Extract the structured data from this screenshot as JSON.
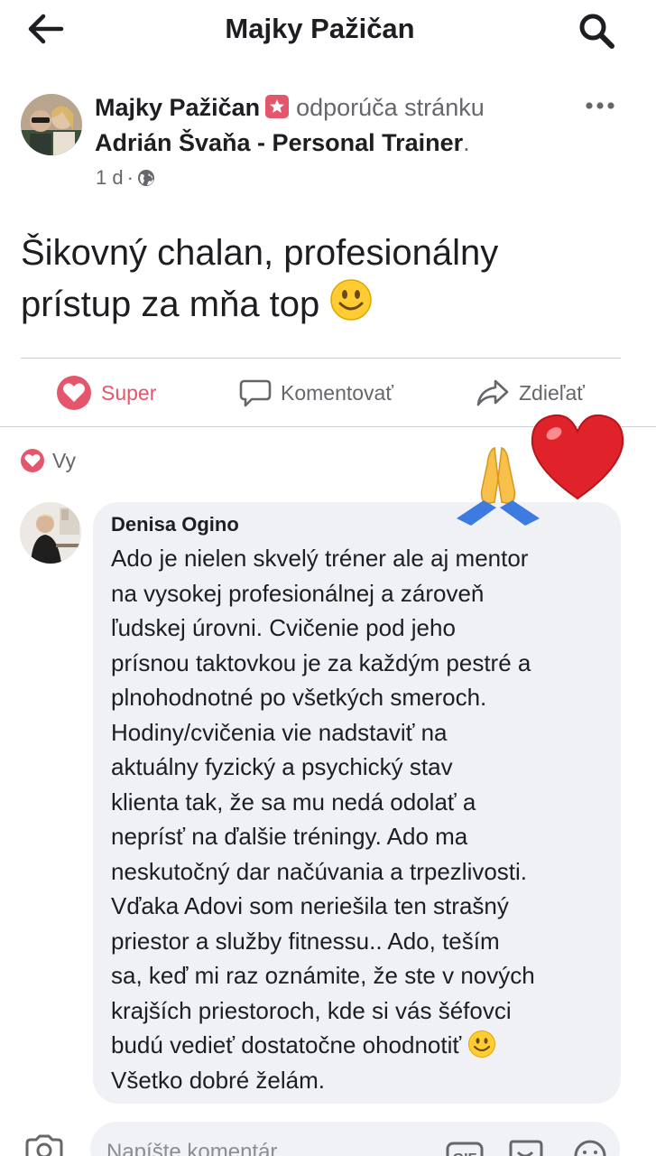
{
  "header": {
    "title": "Majky Pažičan",
    "back_icon": "arrow-left-icon",
    "search_icon": "search-icon"
  },
  "post": {
    "author": "Majky Pažičan",
    "verb": "odporúča stránku",
    "page": "Adrián Švaňa - Personal Trainer",
    "period": ".",
    "time": "1 d",
    "time_separator": "·",
    "privacy_icon": "globe-icon",
    "text_line1": "Šikovný chalan, profesionálny",
    "text_line2": "prístup za mňa top",
    "text_emoji": "slightly-smiling-face"
  },
  "actions": {
    "super": "Super",
    "comment": "Komentovať",
    "share": "Zdieľať"
  },
  "reactions": {
    "label": "Vy",
    "icon": "love-reaction-icon",
    "color": "#e4566c"
  },
  "comment": {
    "author": "Denisa Ogino",
    "lines": [
      "Ado je nielen skvelý tréner ale aj mentor",
      "na vysokej profesionálnej a zároveň",
      "ľudskej úrovni. Cvičenie pod jeho",
      "prísnou taktovkou je za každým pestré a",
      "plnohodnotné po všetkých smeroch.",
      "Hodiny/cvičenia vie nadstaviť na",
      "aktuálny fyzický a psychický stav",
      "klienta tak, že sa mu nedá odolať a",
      "neprísť na ďalšie tréningy.  Ado ma",
      "neskutočný dar načúvania a trpezlivosti.",
      "Vďaka Adovi som neriešila ten strašný",
      "priestor a služby fitnessu.. Ado, teším",
      "sa, keď mi raz oznámite, že ste v nových",
      "krajších priestoroch, kde si vás šéfovci",
      "budú vedieť dostatočne ohodnotiť",
      "Všetko dobré želám."
    ]
  },
  "stickers": [
    "red-heart",
    "folded-hands"
  ],
  "composer": {
    "placeholder": "Napíšte komentár",
    "icons": [
      "camera-icon",
      "gif-icon",
      "sticker-icon",
      "emoji-icon"
    ]
  },
  "colors": {
    "accent": "#e4566c",
    "muted_text": "#65676b",
    "bubble": "#eff1f5"
  }
}
